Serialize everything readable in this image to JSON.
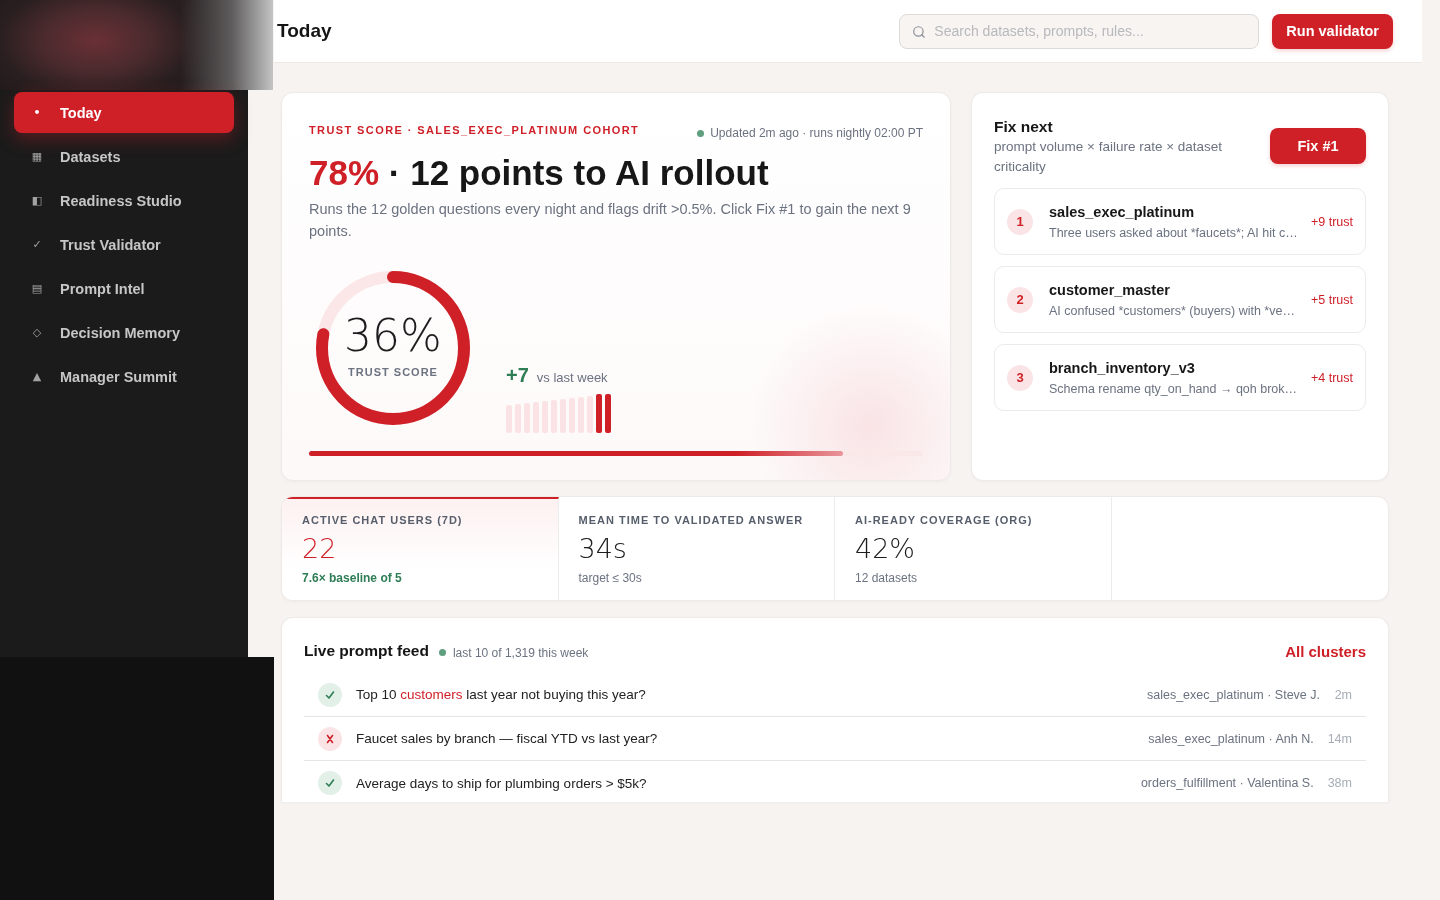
{
  "sidebar": {
    "items": [
      {
        "icon": "•",
        "label": "Today",
        "selected": true
      },
      {
        "icon": "▦",
        "label": "Datasets",
        "selected": false
      },
      {
        "icon": "◧",
        "label": "Readiness Studio",
        "selected": false
      },
      {
        "icon": "✓",
        "label": "Trust Validator",
        "selected": false
      },
      {
        "icon": "▤",
        "label": "Prompt Intel",
        "selected": false
      },
      {
        "icon": "◇",
        "label": "Decision Memory",
        "selected": false
      },
      {
        "icon": "▲",
        "label": "Manager Summit",
        "selected": false
      }
    ]
  },
  "header": {
    "title": "Today",
    "search": {
      "placeholder": "Search datasets, prompts, rules..."
    },
    "primary_button": "Run validator"
  },
  "trust_card": {
    "eyebrow": "TRUST SCORE · SALES_EXEC_PLATINUM COHORT",
    "updated": "Updated 2m ago · runs nightly 02:00 PT",
    "headline": {
      "score": "78%",
      "text": "· 12 points to AI rollout"
    },
    "description": "Runs the 12 golden questions every night and flags drift >0.5%. Click Fix #1 to gain the next 9 points.",
    "ring": {
      "value": "36%",
      "label": "TRUST SCORE",
      "level": 0.78
    },
    "delta": {
      "value": "+7",
      "label": "vs last week"
    },
    "progress": {
      "level": 0.87
    }
  },
  "fix_next": {
    "title": "Fix next",
    "subtitle": "prompt volume × failure rate × dataset criticality",
    "button": "Fix #1",
    "items": [
      {
        "rank": "1",
        "dataset": "sales_exec_platinum",
        "note": "Three users asked about *faucets*; AI hit c…",
        "impact": "+9 trust"
      },
      {
        "rank": "2",
        "dataset": "customer_master",
        "note": "AI confused *customers* (buyers) with *ve…",
        "impact": "+5 trust"
      },
      {
        "rank": "3",
        "dataset": "branch_inventory_v3",
        "note": "Schema rename qty_on_hand → qoh brok…",
        "impact": "+4 trust"
      }
    ]
  },
  "metrics": [
    {
      "label": "ACTIVE CHAT USERS (7D)",
      "value": "22",
      "note": "7.6× baseline of 5",
      "highlighted": true,
      "positive": true
    },
    {
      "label": "MEAN TIME TO VALIDATED ANSWER",
      "value": "34s",
      "note": "target ≤ 30s",
      "highlighted": false,
      "positive": false
    },
    {
      "label": "AI-READY COVERAGE (ORG)",
      "value": "42%",
      "note": "12 datasets",
      "highlighted": false,
      "positive": false
    }
  ],
  "live_feed": {
    "title": "Live prompt feed",
    "subtitle": "last 10 of 1,319 this week",
    "link": "All clusters",
    "rows": [
      {
        "passed": true,
        "question": [
          {
            "text": "Top 10 ",
            "highlight": false
          },
          {
            "text": "customers",
            "highlight": true
          },
          {
            "text": " last year not buying this year?",
            "highlight": false
          }
        ],
        "source": "sales_exec_platinum · Steve J.",
        "age": "2m"
      },
      {
        "passed": false,
        "question": [
          {
            "text": "Faucet sales by branch — fiscal YTD vs last year?",
            "highlight": false
          }
        ],
        "source": "sales_exec_platinum · Anh N.",
        "age": "14m"
      },
      {
        "passed": true,
        "question": [
          {
            "text": "Average days to ship for plumbing orders > $5k?",
            "highlight": false
          }
        ],
        "source": "orders_fulfillment · Valentina S.",
        "age": "38m"
      }
    ]
  }
}
